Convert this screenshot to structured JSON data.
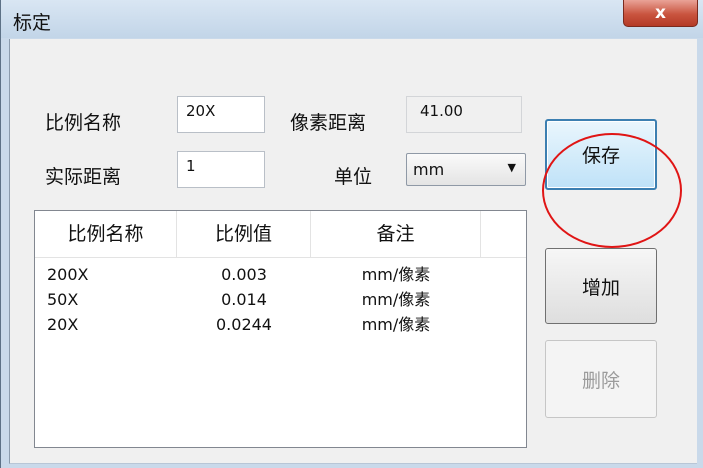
{
  "window": {
    "title": "标定",
    "close_label": "x"
  },
  "form": {
    "ratio_name_label": "比例名称",
    "ratio_name_value": "20X",
    "pixel_distance_label": "像素距离",
    "pixel_distance_value": "41.00",
    "actual_distance_label": "实际距离",
    "actual_distance_value": "1",
    "unit_label": "单位",
    "unit_value": "mm"
  },
  "buttons": {
    "save": "保存",
    "add": "增加",
    "delete": "删除"
  },
  "table": {
    "columns": [
      "比例名称",
      "比例值",
      "备注"
    ],
    "rows": [
      [
        "200X",
        "0.003",
        "mm/像素"
      ],
      [
        "50X",
        "0.014",
        "mm/像素"
      ],
      [
        "20X",
        "0.0244",
        "mm/像素"
      ]
    ]
  },
  "colors": {
    "annotation": "#e01515",
    "title_bar": "#c9d9ea",
    "close_button": "#c9543f"
  },
  "icons": {
    "close": "close-icon",
    "dropdown": "chevron-down-icon"
  }
}
